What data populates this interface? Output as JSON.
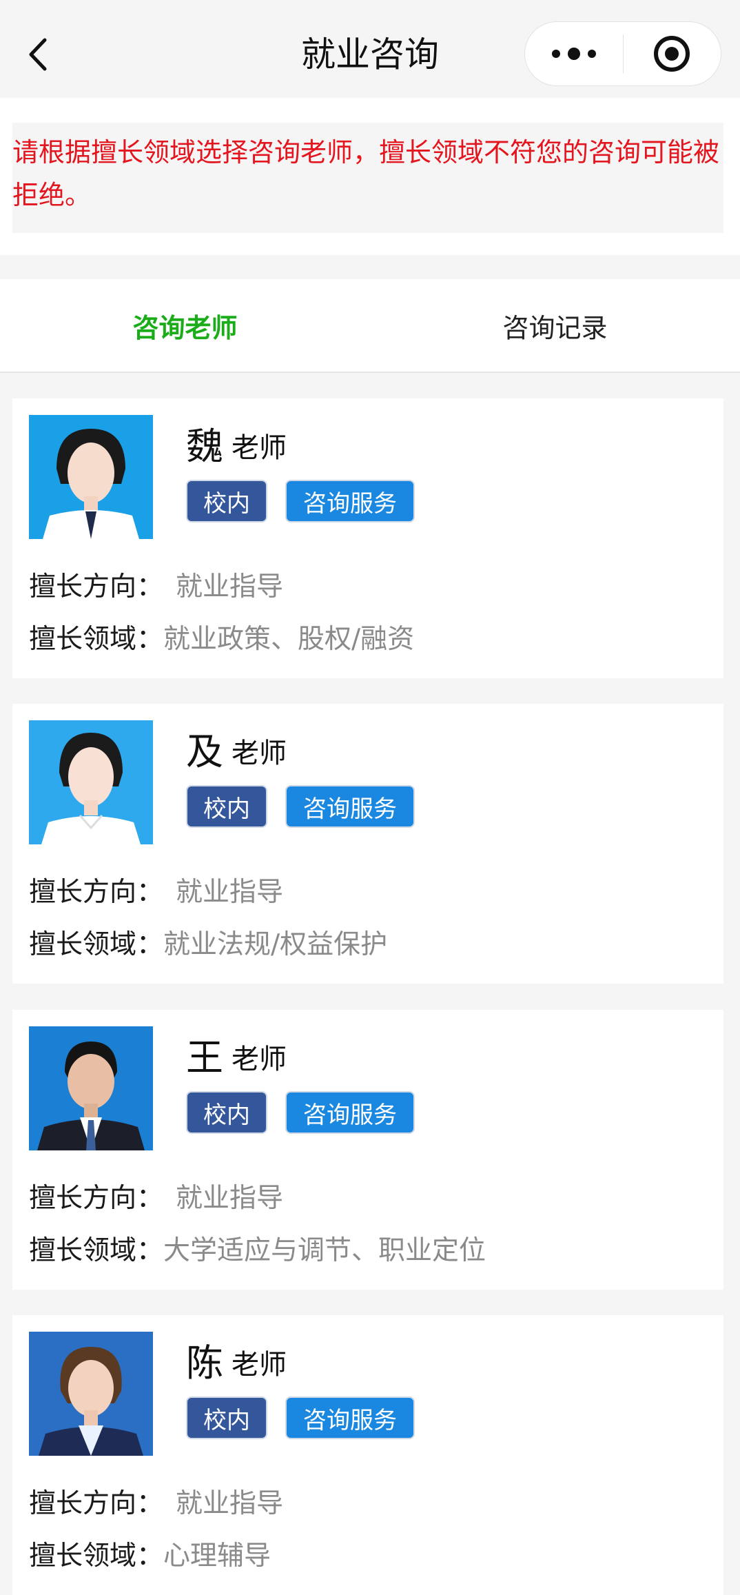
{
  "nav": {
    "title": "就业咨询",
    "back_icon": "chevron-left-icon",
    "more_icon": "more-dots-icon",
    "close_icon": "target-circle-icon"
  },
  "notice": {
    "text": "请根据擅长领域选择咨询老师，擅长领域不符您的咨询可能被拒绝。",
    "color": "#e3151e"
  },
  "tabs": [
    {
      "label": "咨询老师",
      "active": true
    },
    {
      "label": "咨询记录",
      "active": false
    }
  ],
  "colors": {
    "accent_green": "#1aad19",
    "tag_inner": "#34569b",
    "tag_service": "#1a88e0"
  },
  "direction_label": "擅长方向：",
  "field_label": "擅长领域：",
  "teachers": [
    {
      "surname": "魏",
      "title": "老师",
      "tag_inner": "校内",
      "tag_service": "咨询服务",
      "direction": "就业指导",
      "field": "就业政策、股权/融资"
    },
    {
      "surname": "及",
      "title": "老师",
      "tag_inner": "校内",
      "tag_service": "咨询服务",
      "direction": "就业指导",
      "field": "就业法规/权益保护"
    },
    {
      "surname": "王",
      "title": "老师",
      "tag_inner": "校内",
      "tag_service": "咨询服务",
      "direction": "就业指导",
      "field": "大学适应与调节、职业定位"
    },
    {
      "surname": "陈",
      "title": "老师",
      "tag_inner": "校内",
      "tag_service": "咨询服务",
      "direction": "就业指导",
      "field": "心理辅导"
    }
  ]
}
